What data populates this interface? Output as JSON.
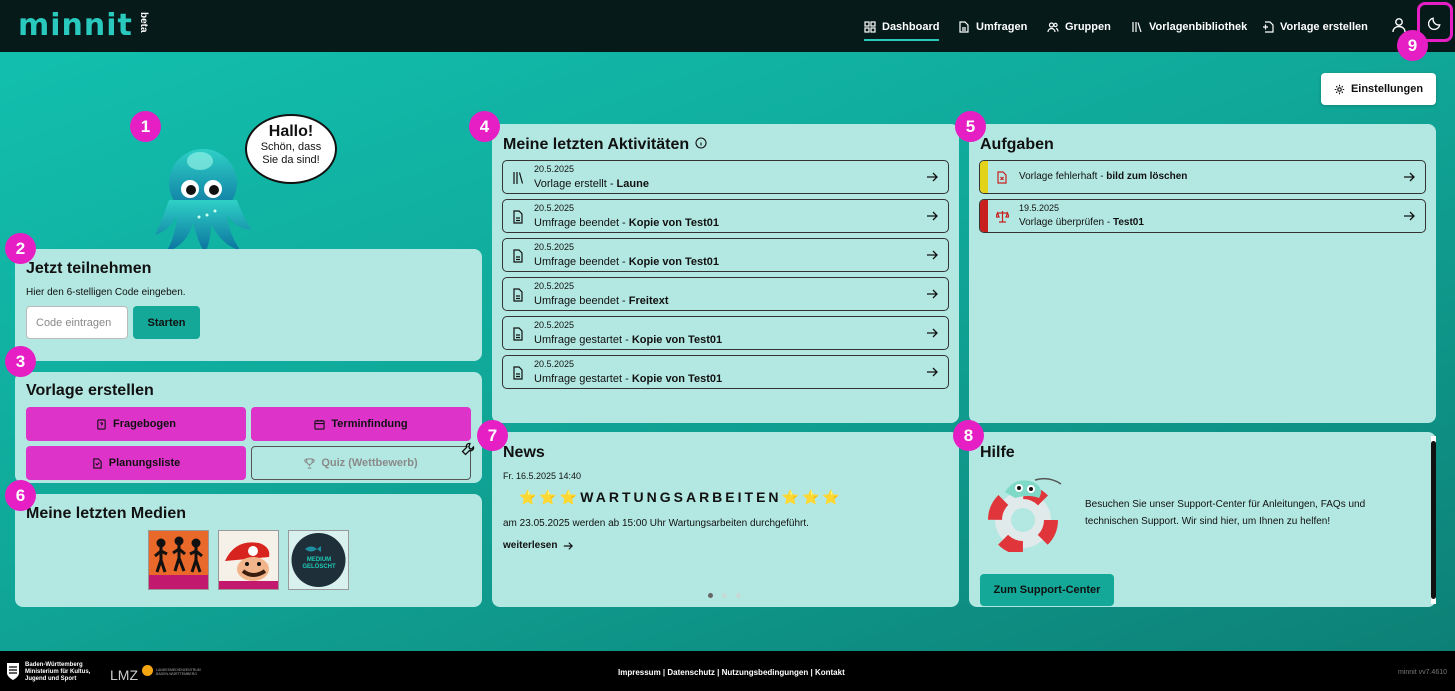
{
  "header": {
    "logo": "minnit",
    "beta": "beta",
    "nav": [
      {
        "label": "Dashboard",
        "icon": "dashboard-icon",
        "active": true
      },
      {
        "label": "Umfragen",
        "icon": "document-icon",
        "active": false
      },
      {
        "label": "Gruppen",
        "icon": "users-icon",
        "active": false
      },
      {
        "label": "Vorlagenbibliothek",
        "icon": "library-icon",
        "active": false
      },
      {
        "label": "Vorlage erstellen",
        "icon": "create-template-icon",
        "active": false
      }
    ]
  },
  "settings_label": "Einstellungen",
  "badges": [
    "1",
    "2",
    "3",
    "4",
    "5",
    "6",
    "7",
    "8",
    "9"
  ],
  "mascot": {
    "greeting": "Hallo!",
    "line1": "Schön, dass",
    "line2": "Sie da sind!"
  },
  "join": {
    "title": "Jetzt teilnehmen",
    "hint": "Hier den 6-stelligen Code eingeben.",
    "placeholder": "Code eintragen",
    "button": "Starten"
  },
  "create": {
    "title": "Vorlage erstellen",
    "buttons": [
      {
        "label": "Fragebogen",
        "icon": "questionnaire-icon"
      },
      {
        "label": "Terminfindung",
        "icon": "calendar-icon"
      },
      {
        "label": "Planungsliste",
        "icon": "list-icon"
      },
      {
        "label": "Quiz (Wettbewerb)",
        "icon": "trophy-icon",
        "disabled": true
      }
    ]
  },
  "media": {
    "title": "Meine letzten Medien",
    "thumb3_text": "MEDIUM GELÖSCHT"
  },
  "activities": {
    "title": "Meine letzten Aktivitäten",
    "items": [
      {
        "date": "20.5.2025",
        "text": "Vorlage erstellt - ",
        "bold": "Laune",
        "icon": "library-icon"
      },
      {
        "date": "20.5.2025",
        "text": "Umfrage beendet - ",
        "bold": "Kopie von Test01",
        "icon": "survey-icon"
      },
      {
        "date": "20.5.2025",
        "text": "Umfrage beendet - ",
        "bold": "Kopie von Test01",
        "icon": "survey-icon"
      },
      {
        "date": "20.5.2025",
        "text": "Umfrage beendet - ",
        "bold": "Freitext",
        "icon": "survey-icon"
      },
      {
        "date": "20.5.2025",
        "text": "Umfrage gestartet - ",
        "bold": "Kopie von Test01",
        "icon": "survey-icon"
      },
      {
        "date": "20.5.2025",
        "text": "Umfrage gestartet - ",
        "bold": "Kopie von Test01",
        "icon": "survey-icon"
      }
    ]
  },
  "tasks": {
    "title": "Aufgaben",
    "items": [
      {
        "date": "",
        "text": "Vorlage fehlerhaft - ",
        "bold": "bild zum löschen",
        "stripe": "#e3d21a",
        "icon": "error-file-icon"
      },
      {
        "date": "19.5.2025",
        "text": "Vorlage überprüfen - ",
        "bold": "Test01",
        "stripe": "#c8201f",
        "icon": "scale-icon"
      }
    ]
  },
  "news": {
    "title": "News",
    "date": "Fr. 16.5.2025 14:40",
    "headline": "⭐⭐⭐WARTUNGSARBEITEN⭐⭐⭐",
    "body": "am 23.05.2025 werden ab 15:00 Uhr Wartungsarbeiten durchgeführt.",
    "more": "weiterlesen"
  },
  "help": {
    "title": "Hilfe",
    "text": "Besuchen Sie unser Support-Center für Anleitungen, FAQs und technischen Support. Wir sind hier, um Ihnen zu helfen!",
    "button": "Zum Support-Center"
  },
  "footer": {
    "org1": "Baden-Württemberg",
    "org2": "Ministerium für Kultus,",
    "org3": "Jugend und Sport",
    "lmz": "LMZ",
    "lmz_sub": "LANDESMEDIENZENTRUM BADEN-WÜRTTEMBERG",
    "links": "Impressum | Datenschutz | Nutzungsbedingungen | Kontakt",
    "version": "minnit vv7.4610"
  },
  "colors": {
    "accent": "#29c9bd",
    "pink": "#e51fc4",
    "card": "#b3e8e2",
    "teal_button": "#13a898"
  }
}
